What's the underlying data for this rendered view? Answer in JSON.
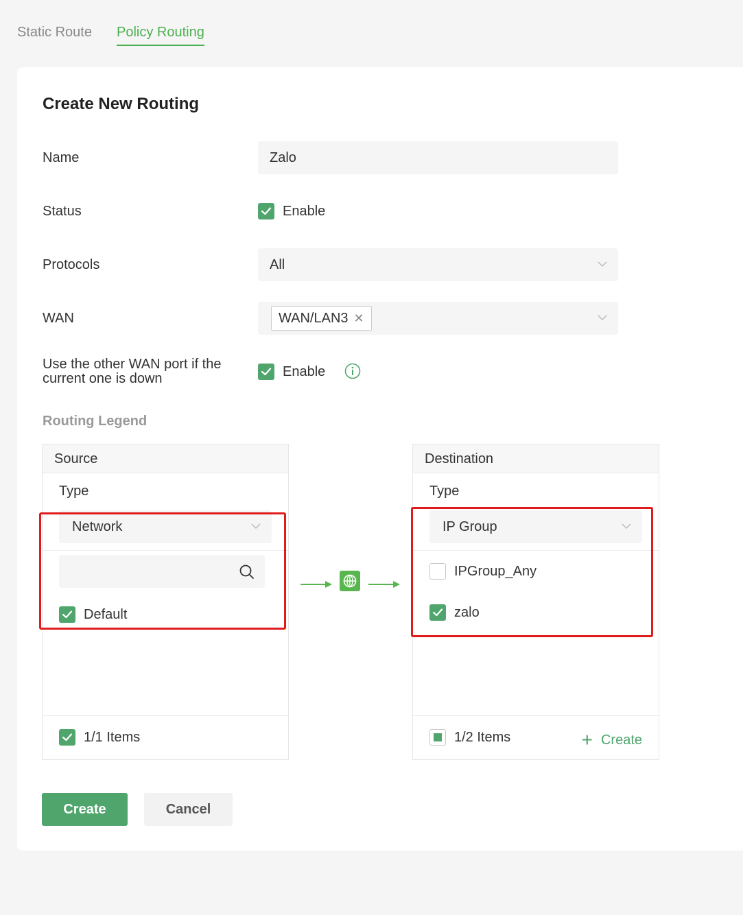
{
  "tabs": {
    "static_route": "Static Route",
    "policy_routing": "Policy Routing"
  },
  "form": {
    "title": "Create New Routing",
    "name_label": "Name",
    "name_value": "Zalo",
    "status_label": "Status",
    "status_option": "Enable",
    "status_checked": true,
    "protocols_label": "Protocols",
    "protocols_value": "All",
    "wan_label": "WAN",
    "wan_tag": "WAN/LAN3",
    "failover_label": "Use the other WAN port if the current one is down",
    "failover_option": "Enable",
    "failover_checked": true
  },
  "legend": {
    "title": "Routing Legend",
    "source": {
      "header": "Source",
      "type_label": "Type",
      "type_value": "Network",
      "search_placeholder": "",
      "items": [
        {
          "label": "Default",
          "checked": true
        }
      ],
      "footer_count": "1/1 Items"
    },
    "destination": {
      "header": "Destination",
      "type_label": "Type",
      "type_value": "IP Group",
      "items": [
        {
          "label": "IPGroup_Any",
          "checked": false
        },
        {
          "label": "zalo",
          "checked": true
        }
      ],
      "footer_count": "1/2 Items",
      "create_label": "Create"
    }
  },
  "actions": {
    "create": "Create",
    "cancel": "Cancel"
  },
  "colors": {
    "accent": "#4fa56c",
    "highlight": "#e01b1b",
    "arrow": "#59b64e"
  }
}
